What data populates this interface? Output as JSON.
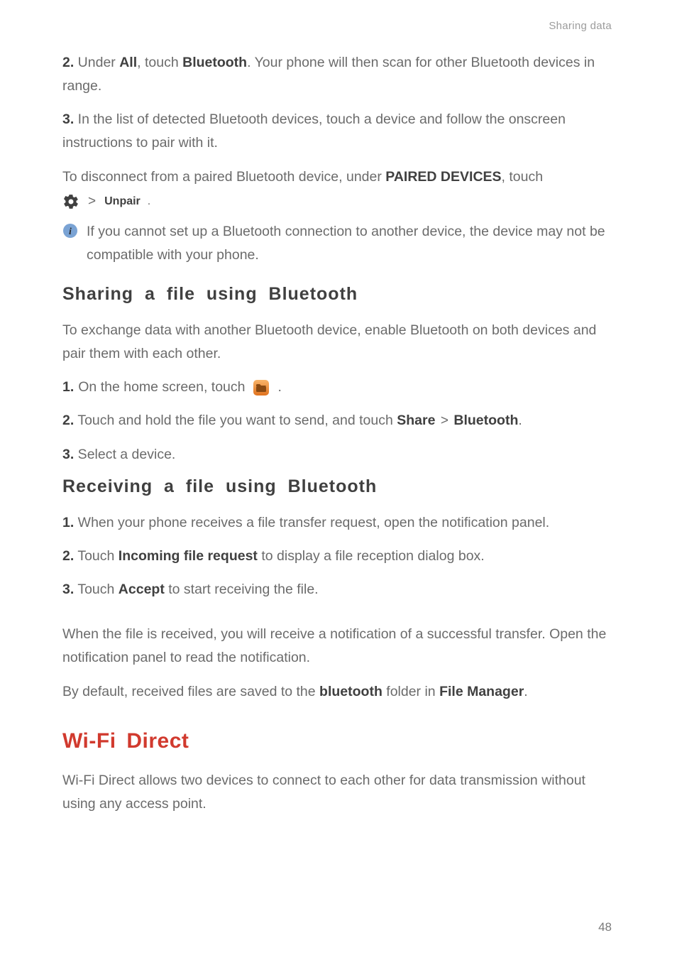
{
  "header": {
    "label": "Sharing data"
  },
  "step2": {
    "num": "2.",
    "pre": " Under ",
    "all": "All",
    "mid": ", touch ",
    "bluetooth": "Bluetooth",
    "post": ". Your phone will then scan for other Bluetooth devices in range."
  },
  "step3": {
    "num": "3.",
    "text": " In the list of detected Bluetooth devices, touch a device and follow the onscreen instructions to pair with it."
  },
  "disconnect": {
    "pre": "To disconnect from a paired Bluetooth device, under ",
    "paired": "PAIRED DEVICES",
    "post": ", touch"
  },
  "unpair": {
    "gt": ">",
    "label": "Unpair",
    "period": "."
  },
  "info": {
    "text": "If you cannot set up a Bluetooth connection to another device, the device may not be compatible with your phone."
  },
  "sharing": {
    "heading": "Sharing  a  file  using  Bluetooth",
    "intro": "To exchange data with another Bluetooth device, enable Bluetooth on both devices and pair them with each other.",
    "s1": {
      "num": "1.",
      "pre": " On the home screen, touch ",
      "period": "."
    },
    "s2": {
      "num": "2.",
      "pre": " Touch and hold the file you want to send, and touch ",
      "share": "Share",
      "gt": ">",
      "bt": "Bluetooth",
      "period": "."
    },
    "s3": {
      "num": "3.",
      "text": " Select a device."
    }
  },
  "receiving": {
    "heading": "Receiving  a  file  using  Bluetooth",
    "s1": {
      "num": "1.",
      "text": " When your phone receives a file transfer request, open the notification panel."
    },
    "s2": {
      "num": "2.",
      "pre": " Touch ",
      "incoming": "Incoming file request",
      "post": " to display a file reception dialog box."
    },
    "s3": {
      "num": "3.",
      "pre": " Touch ",
      "accept": "Accept",
      "post": " to start receiving the file."
    },
    "p1": "When the file is received, you will receive a notification of a successful transfer. Open the notification panel to read the notification.",
    "p2": {
      "pre": "By default, received files are saved to the ",
      "bluetooth": "bluetooth",
      "mid": " folder in ",
      "fm": "File Manager",
      "period": "."
    }
  },
  "wifi": {
    "heading": "Wi-Fi Direct",
    "intro": "Wi-Fi Direct allows two devices to connect to each other for data transmission without using any access point."
  },
  "pageNumber": "48"
}
